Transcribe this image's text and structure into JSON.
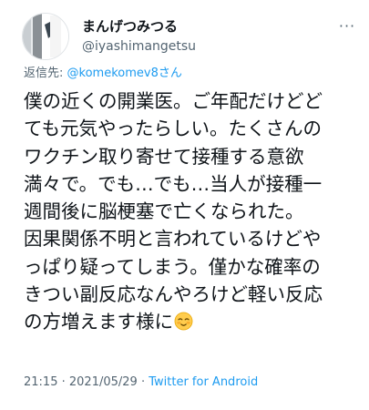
{
  "author": {
    "display_name": "まんげつみつる",
    "handle": "@iyashimangetsu"
  },
  "more_icon": "more-horizontal-icon",
  "reply": {
    "prefix": "返信先: ",
    "mention": "@komekomev8さん"
  },
  "tweet": {
    "lines": [
      "僕の近くの開業医。ご年配だけどど",
      "ても元気やったらしい。たくさんの",
      "ワクチン取り寄せて接種する意欲",
      "満々で。でも…でも…当人が接種一",
      "週間後に脳梗塞で亡くなられた。",
      "因果関係不明と言われているけどや",
      "っぱり疑ってしまう。僅かな確率の",
      "きつい副反応なんやろけど軽い反応",
      "の方増えます様に"
    ],
    "emoji": "relieved-blushing-face-emoji"
  },
  "meta": {
    "time": "21:15",
    "separator1": " · ",
    "date": "2021/05/29",
    "separator2": " · ",
    "source": "Twitter for Android"
  },
  "colors": {
    "text": "#0f1419",
    "secondary": "#536471",
    "link": "#1d9bf0"
  }
}
